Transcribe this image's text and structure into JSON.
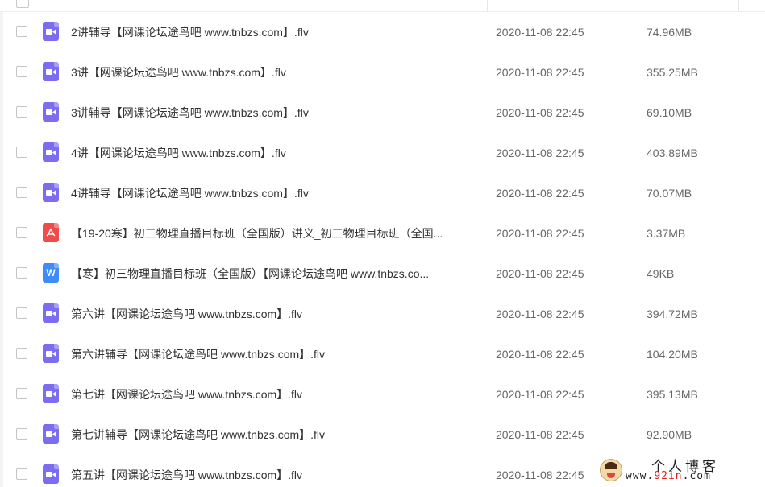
{
  "files": [
    {
      "type": "video",
      "icon": "video-file-icon",
      "name": "2讲辅导【网课论坛途鸟吧 www.tnbzs.com】.flv",
      "date": "2020-11-08 22:45",
      "size": "74.96MB"
    },
    {
      "type": "video",
      "icon": "video-file-icon",
      "name": "3讲【网课论坛途鸟吧 www.tnbzs.com】.flv",
      "date": "2020-11-08 22:45",
      "size": "355.25MB"
    },
    {
      "type": "video",
      "icon": "video-file-icon",
      "name": "3讲辅导【网课论坛途鸟吧 www.tnbzs.com】.flv",
      "date": "2020-11-08 22:45",
      "size": "69.10MB"
    },
    {
      "type": "video",
      "icon": "video-file-icon",
      "name": "4讲【网课论坛途鸟吧 www.tnbzs.com】.flv",
      "date": "2020-11-08 22:45",
      "size": "403.89MB"
    },
    {
      "type": "video",
      "icon": "video-file-icon",
      "name": "4讲辅导【网课论坛途鸟吧 www.tnbzs.com】.flv",
      "date": "2020-11-08 22:45",
      "size": "70.07MB"
    },
    {
      "type": "pdf",
      "icon": "pdf-file-icon",
      "name": "【19-20寒】初三物理直播目标班（全国版）讲义_初三物理目标班（全国...",
      "date": "2020-11-08 22:45",
      "size": "3.37MB"
    },
    {
      "type": "word",
      "icon": "word-file-icon",
      "icon_letter": "W",
      "name": "【寒】初三物理直播目标班（全国版）【网课论坛途鸟吧 www.tnbzs.co...",
      "date": "2020-11-08 22:45",
      "size": "49KB"
    },
    {
      "type": "video",
      "icon": "video-file-icon",
      "name": "第六讲【网课论坛途鸟吧 www.tnbzs.com】.flv",
      "date": "2020-11-08 22:45",
      "size": "394.72MB"
    },
    {
      "type": "video",
      "icon": "video-file-icon",
      "name": "第六讲辅导【网课论坛途鸟吧 www.tnbzs.com】.flv",
      "date": "2020-11-08 22:45",
      "size": "104.20MB"
    },
    {
      "type": "video",
      "icon": "video-file-icon",
      "name": "第七讲【网课论坛途鸟吧 www.tnbzs.com】.flv",
      "date": "2020-11-08 22:45",
      "size": "395.13MB"
    },
    {
      "type": "video",
      "icon": "video-file-icon",
      "name": "第七讲辅导【网课论坛途鸟吧 www.tnbzs.com】.flv",
      "date": "2020-11-08 22:45",
      "size": "92.90MB"
    },
    {
      "type": "video",
      "icon": "video-file-icon",
      "name": "第五讲【网课论坛途鸟吧 www.tnbzs.com】.flv",
      "date": "2020-11-08 22:45",
      "size": ""
    }
  ],
  "watermark": {
    "title": "个人博客",
    "url_prefix": "www.",
    "url_accent": "92in",
    "url_suffix": ".com"
  },
  "colors": {
    "video_icon": "#7b6cf0",
    "pdf_icon": "#ef4b4b",
    "word_icon": "#3d8cf7"
  }
}
